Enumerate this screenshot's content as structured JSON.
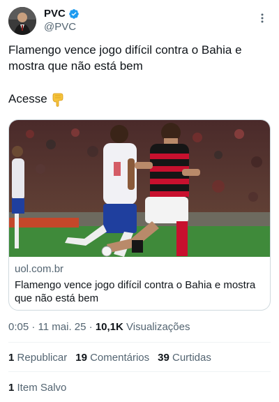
{
  "author": {
    "display_name": "PVC",
    "handle": "@PVC",
    "verified_color": "#1d9bf0"
  },
  "tweet": {
    "text": "Flamengo vence jogo difícil contra o Bahia e mostra que não está bem",
    "cta": "Acesse",
    "cta_emoji": "backhand-index-pointing-down"
  },
  "link_card": {
    "domain": "uol.com.br",
    "title": "Flamengo vence jogo difícil contra o Bahia e mostra que não está bem",
    "image_alt": "football-match-photo"
  },
  "meta": {
    "time": "0:05",
    "date": "11 mai. 25",
    "views_count": "10,1K",
    "views_label": "Visualizações"
  },
  "stats": {
    "reposts_count": "1",
    "reposts_label": "Republicar",
    "comments_count": "19",
    "comments_label": "Comentários",
    "likes_count": "39",
    "likes_label": "Curtidas",
    "saved_count": "1",
    "saved_label": "Item Salvo"
  },
  "colors": {
    "text": "#0f1419",
    "secondary": "#536471",
    "border": "#cfd9de",
    "flamengo_red": "#c8102e",
    "bahia_blue": "#1f3f9e"
  }
}
